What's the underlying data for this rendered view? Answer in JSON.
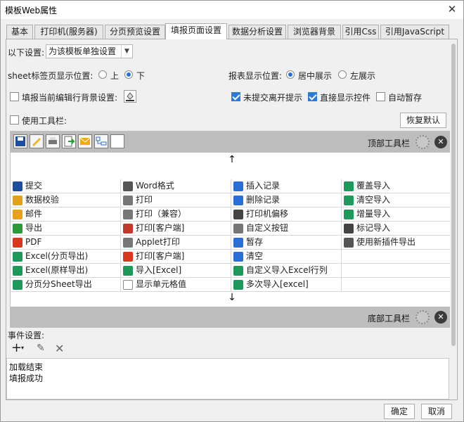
{
  "window": {
    "title": "模板Web属性",
    "close_glyph": "✕"
  },
  "tabs": [
    "基本",
    "打印机(服务器)",
    "分页预览设置",
    "填报页面设置",
    "数据分析设置",
    "浏览器背景",
    "引用Css",
    "引用JavaScript"
  ],
  "active_tab": "填报页面设置",
  "settings": {
    "scope_label": "以下设置:",
    "scope_value": "为该模板单独设置",
    "sheet_tab_label": "sheet标签页显示位置:",
    "sheet_tab_options": [
      "上",
      "下"
    ],
    "sheet_tab_selected": "下",
    "report_pos_label": "报表显示位置:",
    "report_pos_options": [
      "居中展示",
      "左展示"
    ],
    "report_pos_selected": "居中展示",
    "fill_row_bg_label": "填报当前编辑行背景设置:",
    "fill_row_bg_checked": false,
    "unsubmitted_label": "未提交离开提示",
    "unsubmitted_checked": true,
    "direct_show_label": "直接显示控件",
    "direct_show_checked": true,
    "autosave_label": "自动暂存",
    "autosave_checked": false,
    "use_toolbar_label": "使用工具栏:",
    "use_toolbar_checked": false,
    "restore_default": "恢复默认"
  },
  "toolbar": {
    "top_label": "顶部工具栏",
    "bottom_label": "底部工具栏",
    "top_icons": [
      "save-icon",
      "pencil-icon",
      "print-icon",
      "export-icon",
      "mail-icon",
      "insert-row-icon",
      "blank-icon"
    ],
    "up_arrow": "↑",
    "down_arrow": "↓"
  },
  "buttons_grid": [
    [
      {
        "label": "提交",
        "icon": "save-icon",
        "color": "#1c4e9c"
      },
      {
        "label": "Word格式",
        "icon": "word-icon",
        "color": "#555555"
      },
      {
        "label": "插入记录",
        "icon": "insert-row-icon",
        "color": "#2a6fd6"
      },
      {
        "label": "覆盖导入",
        "icon": "excel-icon",
        "color": "#1d9a5b"
      }
    ],
    [
      {
        "label": "数据校验",
        "icon": "check-pencil-icon",
        "color": "#e0a020"
      },
      {
        "label": "打印",
        "icon": "print-icon",
        "color": "#777777"
      },
      {
        "label": "删除记录",
        "icon": "delete-row-icon",
        "color": "#2a6fd6"
      },
      {
        "label": "清空导入",
        "icon": "excel-icon",
        "color": "#1d9a5b"
      }
    ],
    [
      {
        "label": "邮件",
        "icon": "mail-icon",
        "color": "#e8a21a"
      },
      {
        "label": "打印（兼容）",
        "icon": "print-icon",
        "color": "#777777"
      },
      {
        "label": "打印机偏移",
        "icon": "move-icon",
        "color": "#444444"
      },
      {
        "label": "增量导入",
        "icon": "excel-icon",
        "color": "#1d9a5b"
      }
    ],
    [
      {
        "label": "导出",
        "icon": "export-icon",
        "color": "#2a9a3a"
      },
      {
        "label": "打印[客户端]",
        "icon": "pdf-print-icon",
        "color": "#c0392b"
      },
      {
        "label": "自定义按钮",
        "icon": "gear-icon",
        "color": "#777777"
      },
      {
        "label": "标记导入",
        "icon": "mark-import-icon",
        "color": "#444444"
      }
    ],
    [
      {
        "label": "PDF",
        "icon": "pdf-icon",
        "color": "#d9381e"
      },
      {
        "label": "Applet打印",
        "icon": "applet-print-icon",
        "color": "#777777"
      },
      {
        "label": "暂存",
        "icon": "save-icon",
        "color": "#2a6fd6"
      },
      {
        "label": "使用新插件导出",
        "icon": "word-icon",
        "color": "#555555"
      }
    ],
    [
      {
        "label": "Excel(分页导出)",
        "icon": "excel-icon",
        "color": "#1d9a5b"
      },
      {
        "label": "打印[客户端]",
        "icon": "pdf-icon",
        "color": "#d9381e"
      },
      {
        "label": "清空",
        "icon": "eraser-icon",
        "color": "#2a6fd6"
      },
      {
        "label": "",
        "icon": "",
        "color": ""
      }
    ],
    [
      {
        "label": "Excel(原样导出)",
        "icon": "excel-icon",
        "color": "#1d9a5b"
      },
      {
        "label": "导入[Excel]",
        "icon": "excel-icon",
        "color": "#1d9a5b"
      },
      {
        "label": "自定义导入Excel行列",
        "icon": "excel-icon",
        "color": "#1d9a5b"
      },
      {
        "label": "",
        "icon": "",
        "color": ""
      }
    ],
    [
      {
        "label": "分页分Sheet导出",
        "icon": "excel-icon",
        "color": "#1d9a5b"
      },
      {
        "label": "显示单元格值",
        "icon": "blank-icon",
        "color": "#ffffff"
      },
      {
        "label": "多次导入[excel]",
        "icon": "excel-icon",
        "color": "#1d9a5b"
      },
      {
        "label": "",
        "icon": "",
        "color": ""
      }
    ]
  ],
  "events": {
    "label": "事件设置:",
    "items": [
      "加载结束",
      "填报成功"
    ]
  },
  "footer": {
    "ok": "确定",
    "cancel": "取消"
  }
}
